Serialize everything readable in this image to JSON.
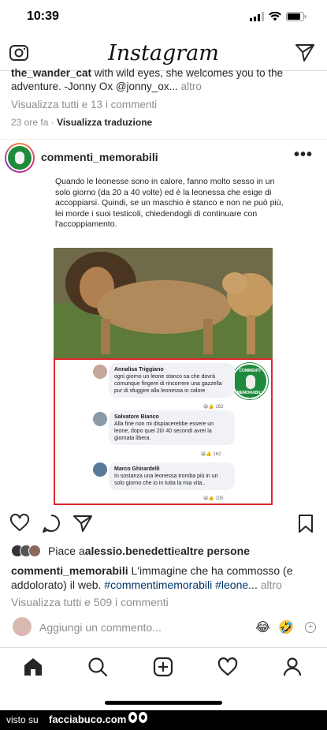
{
  "status_bar": {
    "time": "10:39"
  },
  "header": {
    "app_title": "Instagram"
  },
  "previous_post": {
    "caption_user": "the_wander_cat",
    "caption_text": " with wild eyes, she welcomes you to the adventure. -Jonny Ox ",
    "caption_mention": "@jonny_ox",
    "caption_ellipsis": "...",
    "caption_more": "altro",
    "view_comments": "Visualizza tutti e 13 i commenti",
    "time_ago": "23 ore fa",
    "separator": "·",
    "translate": "Visualizza traduzione"
  },
  "post": {
    "username": "commenti_memorabili",
    "more_label": "•••",
    "image_text": "Quando le leonesse sono in calore,  fanno molto sesso in un solo giorno (da 20 a 40 volte) ed è la leonessa che esige di accoppiarsi. Quindi, se un maschio è stanco e non ne può più, lei morde i suoi testicoli, chiedendogli di continuare con l'accoppiamento.",
    "fb_comments": [
      {
        "name": "Annalisa Triggiano",
        "text": "ogni giorno un leone stanco sa che dovrà comunque fingere di rincorrere una gazzella pur di sfuggire alla leonessa in calore",
        "reactions": "162"
      },
      {
        "name": "Salvatore Bianco",
        "text": "Alla fine non mi dispiacerebbe essere un leone, dopo quei 20/ 40 secondi avrei la giornata libera.",
        "reactions": "162"
      },
      {
        "name": "Marco Ghirardelli",
        "text": "In sostanza una leonessa tromba più in un solo giorno che io in tutta la mia vita..",
        "reactions": "105"
      }
    ],
    "badge_top": "COMMENTI",
    "badge_bottom": "MEMORABILI",
    "likes_prefix": "Piace a ",
    "likes_user": "alessio.benedetti",
    "likes_mid": " e ",
    "likes_others": "altre persone",
    "caption_user": "commenti_memorabili",
    "caption_text": " L'immagine che ha commosso (e addolorato) il web. ",
    "caption_tags": "#commentimemorabili #leone",
    "caption_ellipsis": "... ",
    "caption_more": "altro",
    "view_comments": "Visualizza tutti e 509 i commenti",
    "add_comment_placeholder": "Aggiungi un commento...",
    "emoji_1": "😂",
    "emoji_2": "🤣",
    "add_emoji": "+"
  },
  "watermark": {
    "prefix": "visto su",
    "site": "facciabuco.com"
  },
  "icons": {
    "camera": "camera-icon",
    "direct": "paper-plane-icon",
    "heart": "heart-icon",
    "comment": "comment-icon",
    "share": "share-icon",
    "save": "bookmark-icon",
    "home": "home-icon",
    "search": "search-icon",
    "add": "add-post-icon",
    "activity": "heart-icon",
    "profile": "profile-icon"
  },
  "colors": {
    "accent_red": "#e0262c",
    "brand_green": "#1e8a3e",
    "link": "#00376b",
    "muted": "#8e8e8e"
  }
}
